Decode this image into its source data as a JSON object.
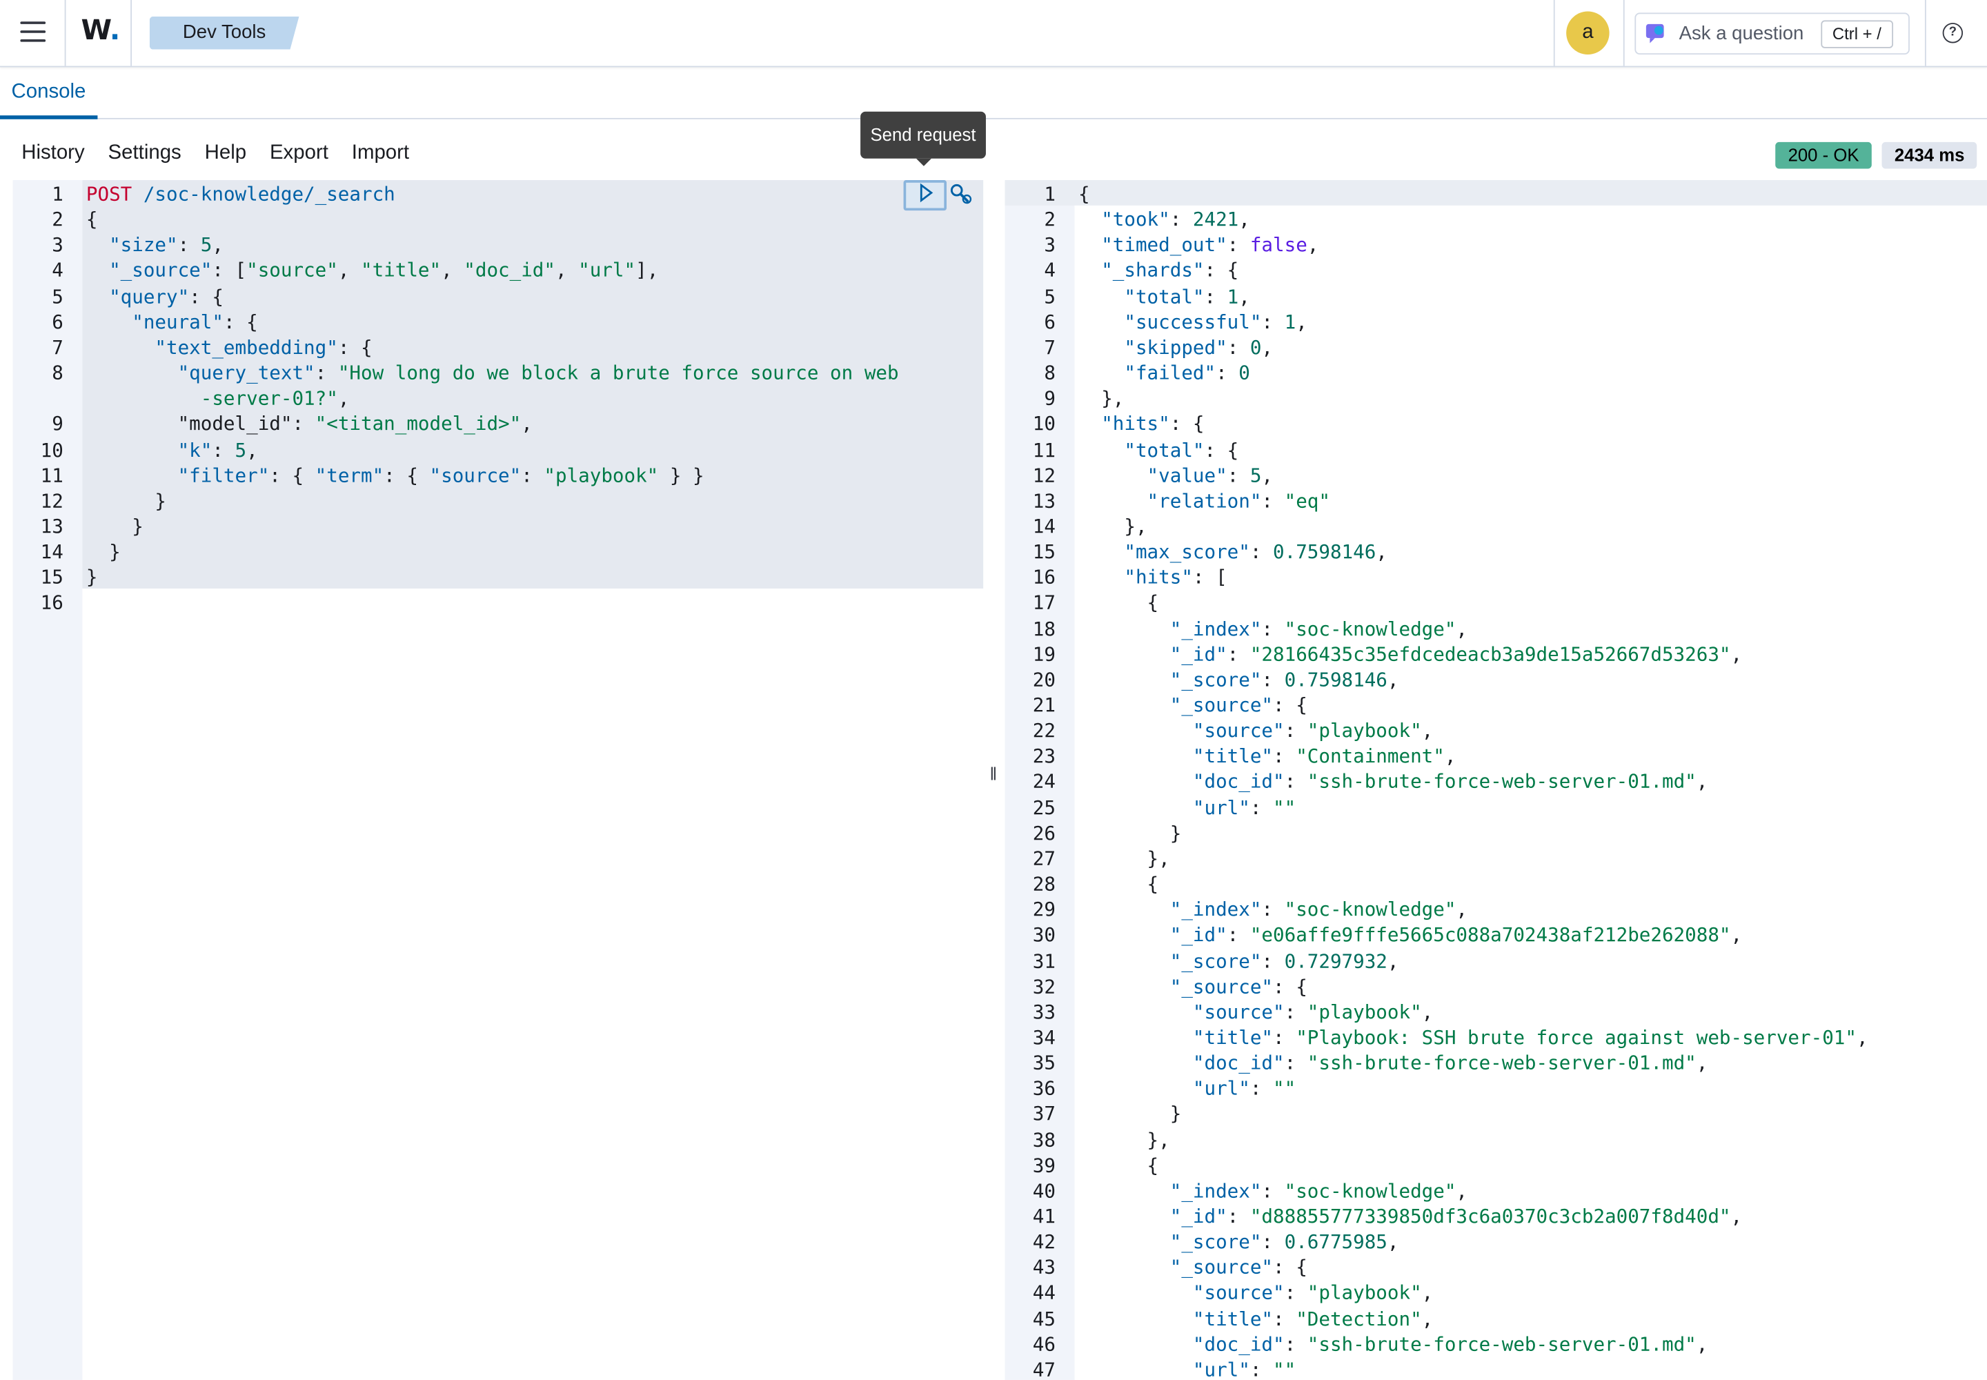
{
  "header": {
    "logo": "W",
    "breadcrumb": "Dev Tools",
    "avatar_letter": "a",
    "ask_label": "Ask a question",
    "ask_shortcut": "Ctrl + /"
  },
  "tabs": [
    "Console"
  ],
  "toolbar": [
    "History",
    "Settings",
    "Help",
    "Export",
    "Import"
  ],
  "tooltip": "Send request",
  "status": {
    "code": "200 - OK",
    "time": "2434 ms"
  },
  "colors": {
    "accent": "#0061a6",
    "ok": "#54b399",
    "string": "#007a47",
    "method": "#c4002e"
  },
  "request_lines": [
    {
      "n": "1",
      "segs": [
        [
          "m",
          "POST"
        ],
        [
          "k",
          " /soc-knowledge/_search"
        ]
      ]
    },
    {
      "n": "2",
      "segs": [
        [
          "p",
          "{"
        ]
      ]
    },
    {
      "n": "3",
      "segs": [
        [
          "k",
          "  \"size\""
        ],
        [
          "p",
          ": "
        ],
        [
          "n",
          "5"
        ],
        [
          "p",
          ","
        ]
      ]
    },
    {
      "n": "4",
      "segs": [
        [
          "k",
          "  \"_source\""
        ],
        [
          "p",
          ": ["
        ],
        [
          "s",
          "\"source\""
        ],
        [
          "p",
          ", "
        ],
        [
          "s",
          "\"title\""
        ],
        [
          "p",
          ", "
        ],
        [
          "s",
          "\"doc_id\""
        ],
        [
          "p",
          ", "
        ],
        [
          "s",
          "\"url\""
        ],
        [
          "p",
          "],"
        ]
      ]
    },
    {
      "n": "5",
      "segs": [
        [
          "k",
          "  \"query\""
        ],
        [
          "p",
          ": {"
        ]
      ]
    },
    {
      "n": "6",
      "segs": [
        [
          "k",
          "    \"neural\""
        ],
        [
          "p",
          ": {"
        ]
      ]
    },
    {
      "n": "7",
      "segs": [
        [
          "k",
          "      \"text_embedding\""
        ],
        [
          "p",
          ": {"
        ]
      ]
    },
    {
      "n": "8",
      "segs": [
        [
          "k",
          "        \"query_text\""
        ],
        [
          "p",
          ": "
        ],
        [
          "s",
          "\"How long do we block a brute force source on web"
        ]
      ]
    },
    {
      "n": "",
      "segs": [
        [
          "s",
          "          -server-01?\""
        ],
        [
          "p",
          ","
        ]
      ]
    },
    {
      "n": "9",
      "segs": [
        [
          "p",
          "        \"model_id\": "
        ],
        [
          "s",
          "\"<titan_model_id>\""
        ],
        [
          "p",
          ","
        ]
      ]
    },
    {
      "n": "10",
      "segs": [
        [
          "k",
          "        \"k\""
        ],
        [
          "p",
          ": "
        ],
        [
          "n",
          "5"
        ],
        [
          "p",
          ","
        ]
      ]
    },
    {
      "n": "11",
      "segs": [
        [
          "k",
          "        \"filter\""
        ],
        [
          "p",
          ": { "
        ],
        [
          "k",
          "\"term\""
        ],
        [
          "p",
          ": { "
        ],
        [
          "k",
          "\"source\""
        ],
        [
          "p",
          ": "
        ],
        [
          "s",
          "\"playbook\""
        ],
        [
          "p",
          " } }"
        ]
      ]
    },
    {
      "n": "12",
      "segs": [
        [
          "p",
          "      }"
        ]
      ]
    },
    {
      "n": "13",
      "segs": [
        [
          "p",
          "    }"
        ]
      ]
    },
    {
      "n": "14",
      "segs": [
        [
          "p",
          "  }"
        ]
      ]
    },
    {
      "n": "15",
      "segs": [
        [
          "p",
          "}"
        ]
      ]
    },
    {
      "n": "16",
      "segs": []
    }
  ],
  "response_lines": [
    {
      "n": "1",
      "segs": [
        [
          "p",
          "{"
        ]
      ]
    },
    {
      "n": "2",
      "segs": [
        [
          "k",
          "  \"took\""
        ],
        [
          "p",
          ": "
        ],
        [
          "n",
          "2421"
        ],
        [
          "p",
          ","
        ]
      ]
    },
    {
      "n": "3",
      "segs": [
        [
          "k",
          "  \"timed_out\""
        ],
        [
          "p",
          ": "
        ],
        [
          "b",
          "false"
        ],
        [
          "p",
          ","
        ]
      ]
    },
    {
      "n": "4",
      "segs": [
        [
          "k",
          "  \"_shards\""
        ],
        [
          "p",
          ": {"
        ]
      ]
    },
    {
      "n": "5",
      "segs": [
        [
          "k",
          "    \"total\""
        ],
        [
          "p",
          ": "
        ],
        [
          "n",
          "1"
        ],
        [
          "p",
          ","
        ]
      ]
    },
    {
      "n": "6",
      "segs": [
        [
          "k",
          "    \"successful\""
        ],
        [
          "p",
          ": "
        ],
        [
          "n",
          "1"
        ],
        [
          "p",
          ","
        ]
      ]
    },
    {
      "n": "7",
      "segs": [
        [
          "k",
          "    \"skipped\""
        ],
        [
          "p",
          ": "
        ],
        [
          "n",
          "0"
        ],
        [
          "p",
          ","
        ]
      ]
    },
    {
      "n": "8",
      "segs": [
        [
          "k",
          "    \"failed\""
        ],
        [
          "p",
          ": "
        ],
        [
          "n",
          "0"
        ]
      ]
    },
    {
      "n": "9",
      "segs": [
        [
          "p",
          "  },"
        ]
      ]
    },
    {
      "n": "10",
      "segs": [
        [
          "k",
          "  \"hits\""
        ],
        [
          "p",
          ": {"
        ]
      ]
    },
    {
      "n": "11",
      "segs": [
        [
          "k",
          "    \"total\""
        ],
        [
          "p",
          ": {"
        ]
      ]
    },
    {
      "n": "12",
      "segs": [
        [
          "k",
          "      \"value\""
        ],
        [
          "p",
          ": "
        ],
        [
          "n",
          "5"
        ],
        [
          "p",
          ","
        ]
      ]
    },
    {
      "n": "13",
      "segs": [
        [
          "k",
          "      \"relation\""
        ],
        [
          "p",
          ": "
        ],
        [
          "s",
          "\"eq\""
        ]
      ]
    },
    {
      "n": "14",
      "segs": [
        [
          "p",
          "    },"
        ]
      ]
    },
    {
      "n": "15",
      "segs": [
        [
          "k",
          "    \"max_score\""
        ],
        [
          "p",
          ": "
        ],
        [
          "n",
          "0.7598146"
        ],
        [
          "p",
          ","
        ]
      ]
    },
    {
      "n": "16",
      "segs": [
        [
          "k",
          "    \"hits\""
        ],
        [
          "p",
          ": ["
        ]
      ]
    },
    {
      "n": "17",
      "segs": [
        [
          "p",
          "      {"
        ]
      ]
    },
    {
      "n": "18",
      "segs": [
        [
          "k",
          "        \"_index\""
        ],
        [
          "p",
          ": "
        ],
        [
          "s",
          "\"soc-knowledge\""
        ],
        [
          "p",
          ","
        ]
      ]
    },
    {
      "n": "19",
      "segs": [
        [
          "k",
          "        \"_id\""
        ],
        [
          "p",
          ": "
        ],
        [
          "s",
          "\"28166435c35efdcedeacb3a9de15a52667d53263\""
        ],
        [
          "p",
          ","
        ]
      ]
    },
    {
      "n": "20",
      "segs": [
        [
          "k",
          "        \"_score\""
        ],
        [
          "p",
          ": "
        ],
        [
          "n",
          "0.7598146"
        ],
        [
          "p",
          ","
        ]
      ]
    },
    {
      "n": "21",
      "segs": [
        [
          "k",
          "        \"_source\""
        ],
        [
          "p",
          ": {"
        ]
      ]
    },
    {
      "n": "22",
      "segs": [
        [
          "k",
          "          \"source\""
        ],
        [
          "p",
          ": "
        ],
        [
          "s",
          "\"playbook\""
        ],
        [
          "p",
          ","
        ]
      ]
    },
    {
      "n": "23",
      "segs": [
        [
          "k",
          "          \"title\""
        ],
        [
          "p",
          ": "
        ],
        [
          "s",
          "\"Containment\""
        ],
        [
          "p",
          ","
        ]
      ]
    },
    {
      "n": "24",
      "segs": [
        [
          "k",
          "          \"doc_id\""
        ],
        [
          "p",
          ": "
        ],
        [
          "s",
          "\"ssh-brute-force-web-server-01.md\""
        ],
        [
          "p",
          ","
        ]
      ]
    },
    {
      "n": "25",
      "segs": [
        [
          "k",
          "          \"url\""
        ],
        [
          "p",
          ": "
        ],
        [
          "s",
          "\"\""
        ]
      ]
    },
    {
      "n": "26",
      "segs": [
        [
          "p",
          "        }"
        ]
      ]
    },
    {
      "n": "27",
      "segs": [
        [
          "p",
          "      },"
        ]
      ]
    },
    {
      "n": "28",
      "segs": [
        [
          "p",
          "      {"
        ]
      ]
    },
    {
      "n": "29",
      "segs": [
        [
          "k",
          "        \"_index\""
        ],
        [
          "p",
          ": "
        ],
        [
          "s",
          "\"soc-knowledge\""
        ],
        [
          "p",
          ","
        ]
      ]
    },
    {
      "n": "30",
      "segs": [
        [
          "k",
          "        \"_id\""
        ],
        [
          "p",
          ": "
        ],
        [
          "s",
          "\"e06affe9fffe5665c088a702438af212be262088\""
        ],
        [
          "p",
          ","
        ]
      ]
    },
    {
      "n": "31",
      "segs": [
        [
          "k",
          "        \"_score\""
        ],
        [
          "p",
          ": "
        ],
        [
          "n",
          "0.7297932"
        ],
        [
          "p",
          ","
        ]
      ]
    },
    {
      "n": "32",
      "segs": [
        [
          "k",
          "        \"_source\""
        ],
        [
          "p",
          ": {"
        ]
      ]
    },
    {
      "n": "33",
      "segs": [
        [
          "k",
          "          \"source\""
        ],
        [
          "p",
          ": "
        ],
        [
          "s",
          "\"playbook\""
        ],
        [
          "p",
          ","
        ]
      ]
    },
    {
      "n": "34",
      "segs": [
        [
          "k",
          "          \"title\""
        ],
        [
          "p",
          ": "
        ],
        [
          "s",
          "\"Playbook: SSH brute force against web-server-01\""
        ],
        [
          "p",
          ","
        ]
      ]
    },
    {
      "n": "35",
      "segs": [
        [
          "k",
          "          \"doc_id\""
        ],
        [
          "p",
          ": "
        ],
        [
          "s",
          "\"ssh-brute-force-web-server-01.md\""
        ],
        [
          "p",
          ","
        ]
      ]
    },
    {
      "n": "36",
      "segs": [
        [
          "k",
          "          \"url\""
        ],
        [
          "p",
          ": "
        ],
        [
          "s",
          "\"\""
        ]
      ]
    },
    {
      "n": "37",
      "segs": [
        [
          "p",
          "        }"
        ]
      ]
    },
    {
      "n": "38",
      "segs": [
        [
          "p",
          "      },"
        ]
      ]
    },
    {
      "n": "39",
      "segs": [
        [
          "p",
          "      {"
        ]
      ]
    },
    {
      "n": "40",
      "segs": [
        [
          "k",
          "        \"_index\""
        ],
        [
          "p",
          ": "
        ],
        [
          "s",
          "\"soc-knowledge\""
        ],
        [
          "p",
          ","
        ]
      ]
    },
    {
      "n": "41",
      "segs": [
        [
          "k",
          "        \"_id\""
        ],
        [
          "p",
          ": "
        ],
        [
          "s",
          "\"d88855777339850df3c6a0370c3cb2a007f8d40d\""
        ],
        [
          "p",
          ","
        ]
      ]
    },
    {
      "n": "42",
      "segs": [
        [
          "k",
          "        \"_score\""
        ],
        [
          "p",
          ": "
        ],
        [
          "n",
          "0.6775985"
        ],
        [
          "p",
          ","
        ]
      ]
    },
    {
      "n": "43",
      "segs": [
        [
          "k",
          "        \"_source\""
        ],
        [
          "p",
          ": {"
        ]
      ]
    },
    {
      "n": "44",
      "segs": [
        [
          "k",
          "          \"source\""
        ],
        [
          "p",
          ": "
        ],
        [
          "s",
          "\"playbook\""
        ],
        [
          "p",
          ","
        ]
      ]
    },
    {
      "n": "45",
      "segs": [
        [
          "k",
          "          \"title\""
        ],
        [
          "p",
          ": "
        ],
        [
          "s",
          "\"Detection\""
        ],
        [
          "p",
          ","
        ]
      ]
    },
    {
      "n": "46",
      "segs": [
        [
          "k",
          "          \"doc_id\""
        ],
        [
          "p",
          ": "
        ],
        [
          "s",
          "\"ssh-brute-force-web-server-01.md\""
        ],
        [
          "p",
          ","
        ]
      ]
    },
    {
      "n": "47",
      "segs": [
        [
          "k",
          "          \"url\""
        ],
        [
          "p",
          ": "
        ],
        [
          "s",
          "\"\""
        ]
      ]
    }
  ]
}
